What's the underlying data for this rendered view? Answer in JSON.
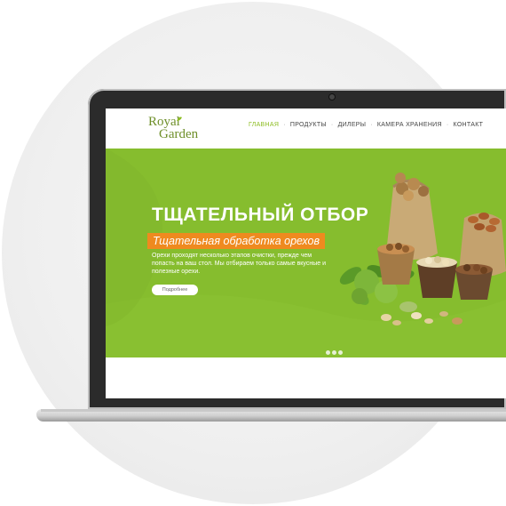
{
  "brand": {
    "logo_line1": "Royal",
    "logo_line2": "Garden"
  },
  "nav": {
    "items": [
      {
        "label": "ГЛАВНАЯ",
        "active": true
      },
      {
        "label": "ПРОДУКТЫ",
        "active": false
      },
      {
        "label": "ДИЛЕРЫ",
        "active": false
      },
      {
        "label": "КАМЕРА ХРАНЕНИЯ",
        "active": false
      },
      {
        "label": "КОНТАКТ",
        "active": false
      }
    ],
    "separator": "·"
  },
  "hero": {
    "title": "ТЩАТЕЛЬНЫЙ ОТБОР",
    "subtitle": "Тщательная обработка орехов",
    "description": "Орехи проходят несколько этапов очистки, прежде чем попасть на ваш стол. Мы отбираем только самые вкусные и полезные орехи.",
    "button_label": "Подробнее",
    "slides_count": 3,
    "active_slide": 1
  },
  "colors": {
    "hero_green": "#86bd2e",
    "accent_orange": "#ef8a1f",
    "nav_active": "#8dbd22",
    "logo_green": "#6e8f2a"
  }
}
